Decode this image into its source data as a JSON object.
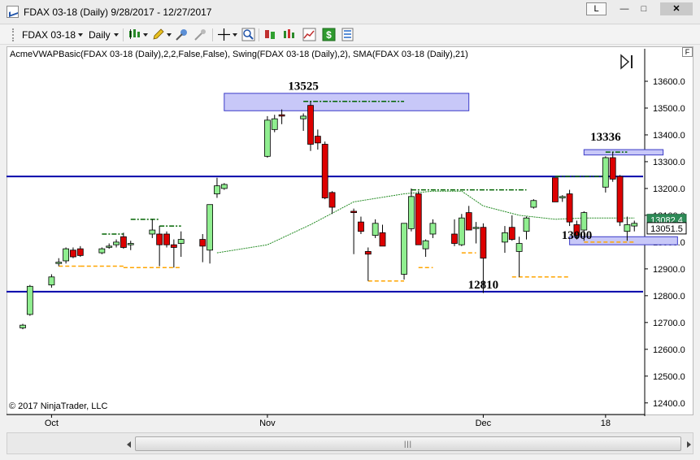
{
  "window": {
    "title": "FDAX 03-18 (Daily)  9/28/2017 - 12/27/2017",
    "link_button": "L",
    "minimize": "—",
    "maximize": "□",
    "close": "✕"
  },
  "toolbar": {
    "instrument": "FDAX 03-18",
    "period": "Daily",
    "icons": [
      "bar-type-icon",
      "drawing-pencil-icon",
      "global-draw-icon",
      "stay-in-draw-icon",
      "crosshair-icon",
      "zoom-icon",
      "strategies-icon",
      "indicators-icon",
      "chart-trader-icon",
      "properties-icon"
    ]
  },
  "chart": {
    "indicator_label": "AcmeVWAPBasic(FDAX 03-18 (Daily),2,2,False,False), Swing(FDAX 03-18 (Daily),2), SMA(FDAX 03-18 (Daily),21)",
    "copyright": "© 2017 NinjaTrader, LLC",
    "panel_marker": "F"
  },
  "colors": {
    "up_candle": "#90ee90",
    "down_candle": "#dd0000",
    "candle_outline": "#000000",
    "sma": "#228b22",
    "swing_high": "#006400",
    "swing_low": "#ffa500",
    "level_line": "#0000aa",
    "zone_fill": "#c8c8f8",
    "zone_stroke": "#3c3cc8"
  },
  "chart_data": {
    "type": "candlestick",
    "instrument": "FDAX 03-18 (Daily)",
    "date_range": "9/28/2017 - 12/27/2017",
    "ylim": [
      12350,
      13690
    ],
    "y_ticks": [
      12400,
      12500,
      12600,
      12700,
      12800,
      12900,
      13000,
      13100,
      13200,
      13300,
      13400,
      13500,
      13600
    ],
    "x_ticks": [
      {
        "label": "Oct",
        "date": "2017-10-02"
      },
      {
        "label": "Nov",
        "date": "2017-11-01"
      },
      {
        "label": "Dec",
        "date": "2017-12-01"
      },
      {
        "label": "18",
        "date": "2017-12-18"
      }
    ],
    "candles": [
      {
        "date": "2017-09-28",
        "open": 12680,
        "high": 12695,
        "low": 12675,
        "close": 12690
      },
      {
        "date": "2017-09-29",
        "open": 12730,
        "high": 12840,
        "low": 12725,
        "close": 12835
      },
      {
        "date": "2017-10-02",
        "open": 12840,
        "high": 12880,
        "low": 12830,
        "close": 12870
      },
      {
        "date": "2017-10-03",
        "open": 12920,
        "high": 12940,
        "low": 12910,
        "close": 12925
      },
      {
        "date": "2017-10-04",
        "open": 12930,
        "high": 12980,
        "low": 12920,
        "close": 12975
      },
      {
        "date": "2017-10-05",
        "open": 12970,
        "high": 12980,
        "low": 12940,
        "close": 12945
      },
      {
        "date": "2017-10-06",
        "open": 12975,
        "high": 12985,
        "low": 12945,
        "close": 12950
      },
      {
        "date": "2017-10-09",
        "open": 12960,
        "high": 12980,
        "low": 12955,
        "close": 12975
      },
      {
        "date": "2017-10-10",
        "open": 12985,
        "high": 12995,
        "low": 12975,
        "close": 12985
      },
      {
        "date": "2017-10-11",
        "open": 12990,
        "high": 13010,
        "low": 12980,
        "close": 13000
      },
      {
        "date": "2017-10-12",
        "open": 13020,
        "high": 13035,
        "low": 12975,
        "close": 12980
      },
      {
        "date": "2017-10-13",
        "open": 12990,
        "high": 13005,
        "low": 12970,
        "close": 12995
      },
      {
        "date": "2017-10-16",
        "open": 13030,
        "high": 13085,
        "low": 13015,
        "close": 13045
      },
      {
        "date": "2017-10-17",
        "open": 13030,
        "high": 13060,
        "low": 12910,
        "close": 12990
      },
      {
        "date": "2017-10-18",
        "open": 13030,
        "high": 13040,
        "low": 12980,
        "close": 12990
      },
      {
        "date": "2017-10-19",
        "open": 12990,
        "high": 13010,
        "low": 12905,
        "close": 12980
      },
      {
        "date": "2017-10-20",
        "open": 12995,
        "high": 13040,
        "low": 12945,
        "close": 13010
      },
      {
        "date": "2017-10-23",
        "open": 13010,
        "high": 13030,
        "low": 12925,
        "close": 12985
      },
      {
        "date": "2017-10-24",
        "open": 12970,
        "high": 13140,
        "low": 12920,
        "close": 13140
      },
      {
        "date": "2017-10-25",
        "open": 13180,
        "high": 13240,
        "low": 13165,
        "close": 13210
      },
      {
        "date": "2017-10-26",
        "open": 13200,
        "high": 13220,
        "low": 13195,
        "close": 13215
      },
      {
        "date": "2017-11-01",
        "open": 13320,
        "high": 13470,
        "low": 13315,
        "close": 13455
      },
      {
        "date": "2017-11-02",
        "open": 13420,
        "high": 13475,
        "low": 13410,
        "close": 13460
      },
      {
        "date": "2017-11-03",
        "open": 13475,
        "high": 13495,
        "low": 13440,
        "close": 13470
      },
      {
        "date": "2017-11-06",
        "open": 13460,
        "high": 13480,
        "low": 13415,
        "close": 13470
      },
      {
        "date": "2017-11-07",
        "open": 13510,
        "high": 13525,
        "low": 13340,
        "close": 13365
      },
      {
        "date": "2017-11-08",
        "open": 13395,
        "high": 13420,
        "low": 13345,
        "close": 13370
      },
      {
        "date": "2017-11-09",
        "open": 13365,
        "high": 13375,
        "low": 13160,
        "close": 13165
      },
      {
        "date": "2017-11-10",
        "open": 13185,
        "high": 13190,
        "low": 13105,
        "close": 13130
      },
      {
        "date": "2017-11-13",
        "open": 13115,
        "high": 13125,
        "low": 12955,
        "close": 13110
      },
      {
        "date": "2017-11-14",
        "open": 13075,
        "high": 13095,
        "low": 13030,
        "close": 13040
      },
      {
        "date": "2017-11-15",
        "open": 12965,
        "high": 12980,
        "low": 12855,
        "close": 12955
      },
      {
        "date": "2017-11-16",
        "open": 13025,
        "high": 13085,
        "low": 13015,
        "close": 13070
      },
      {
        "date": "2017-11-17",
        "open": 13035,
        "high": 13065,
        "low": 12985,
        "close": 12985
      },
      {
        "date": "2017-11-20",
        "open": 12880,
        "high": 12905,
        "low": 12860,
        "close": 13070
      },
      {
        "date": "2017-11-21",
        "open": 13050,
        "high": 13200,
        "low": 13040,
        "close": 13170
      },
      {
        "date": "2017-11-22",
        "open": 13180,
        "high": 13190,
        "low": 12990,
        "close": 12990
      },
      {
        "date": "2017-11-23",
        "open": 12975,
        "high": 13010,
        "low": 12945,
        "close": 13005
      },
      {
        "date": "2017-11-24",
        "open": 13030,
        "high": 13085,
        "low": 13015,
        "close": 13070
      },
      {
        "date": "2017-11-27",
        "open": 13030,
        "high": 13085,
        "low": 12985,
        "close": 12995
      },
      {
        "date": "2017-11-28",
        "open": 12990,
        "high": 13105,
        "low": 12985,
        "close": 13090
      },
      {
        "date": "2017-11-29",
        "open": 13110,
        "high": 13135,
        "low": 13045,
        "close": 13045
      },
      {
        "date": "2017-11-30",
        "open": 13055,
        "high": 13075,
        "low": 12995,
        "close": 13055
      },
      {
        "date": "2017-12-01",
        "open": 13055,
        "high": 13070,
        "low": 12810,
        "close": 12940
      },
      {
        "date": "2017-12-04",
        "open": 13000,
        "high": 13060,
        "low": 12960,
        "close": 13035
      },
      {
        "date": "2017-12-05",
        "open": 13055,
        "high": 13100,
        "low": 13005,
        "close": 13010
      },
      {
        "date": "2017-12-06",
        "open": 12965,
        "high": 13020,
        "low": 12870,
        "close": 12995
      },
      {
        "date": "2017-12-07",
        "open": 13040,
        "high": 13095,
        "low": 13010,
        "close": 13090
      },
      {
        "date": "2017-12-08",
        "open": 13130,
        "high": 13160,
        "low": 13125,
        "close": 13155
      },
      {
        "date": "2017-12-11",
        "open": 13240,
        "high": 13240,
        "low": 13150,
        "close": 13150
      },
      {
        "date": "2017-12-12",
        "open": 13165,
        "high": 13175,
        "low": 13150,
        "close": 13170
      },
      {
        "date": "2017-12-13",
        "open": 13180,
        "high": 13195,
        "low": 13060,
        "close": 13075
      },
      {
        "date": "2017-12-14",
        "open": 13065,
        "high": 13080,
        "low": 13010,
        "close": 13025
      },
      {
        "date": "2017-12-15",
        "open": 13045,
        "high": 13115,
        "low": 13005,
        "close": 13110
      },
      {
        "date": "2017-12-18",
        "open": 13205,
        "high": 13320,
        "low": 13185,
        "close": 13315
      },
      {
        "date": "2017-12-19",
        "open": 13315,
        "high": 13336,
        "low": 13225,
        "close": 13235
      },
      {
        "date": "2017-12-20",
        "open": 13245,
        "high": 13250,
        "low": 13060,
        "close": 13075
      },
      {
        "date": "2017-12-21",
        "open": 13040,
        "high": 13095,
        "low": 13005,
        "close": 13065
      },
      {
        "date": "2017-12-22",
        "open": 13060,
        "high": 13080,
        "low": 13040,
        "close": 13070
      },
      {
        "date": "2017-12-27",
        "open": 13051,
        "high": 13060,
        "low": 13040,
        "close": 13051
      }
    ],
    "sma": {
      "name": "SMA(FDAX 03-18 (Daily),21)",
      "points": [
        {
          "date": "2017-10-25",
          "value": 12960
        },
        {
          "date": "2017-11-01",
          "value": 12990
        },
        {
          "date": "2017-11-07",
          "value": 13065
        },
        {
          "date": "2017-11-13",
          "value": 13150
        },
        {
          "date": "2017-11-20",
          "value": 13180
        },
        {
          "date": "2017-11-24",
          "value": 13190
        },
        {
          "date": "2017-11-28",
          "value": 13190
        },
        {
          "date": "2017-12-01",
          "value": 13135
        },
        {
          "date": "2017-12-06",
          "value": 13100
        },
        {
          "date": "2017-12-11",
          "value": 13085
        },
        {
          "date": "2017-12-15",
          "value": 13090
        },
        {
          "date": "2017-12-22",
          "value": 13090
        }
      ]
    },
    "swing_highs": [
      {
        "from": "2017-10-09",
        "to": "2017-10-12",
        "value": 13030
      },
      {
        "from": "2017-10-13",
        "to": "2017-10-17",
        "value": 13085
      },
      {
        "from": "2017-10-17",
        "to": "2017-10-20",
        "value": 13060
      },
      {
        "from": "2017-11-06",
        "to": "2017-11-20",
        "value": 13525
      },
      {
        "from": "2017-11-21",
        "to": "2017-12-07",
        "value": 13195
      },
      {
        "from": "2017-12-11",
        "to": "2017-12-19",
        "value": 13245
      },
      {
        "from": "2017-12-18",
        "to": "2017-12-21",
        "value": 13336
      }
    ],
    "swing_lows": [
      {
        "from": "2017-10-03",
        "to": "2017-10-06",
        "value": 12910
      },
      {
        "from": "2017-10-06",
        "to": "2017-10-12",
        "value": 12910
      },
      {
        "from": "2017-10-12",
        "to": "2017-10-20",
        "value": 12905
      },
      {
        "from": "2017-11-15",
        "to": "2017-11-20",
        "value": 12855
      },
      {
        "from": "2017-11-22",
        "to": "2017-11-24",
        "value": 12905
      },
      {
        "from": "2017-11-28",
        "to": "2017-11-30",
        "value": 12960
      },
      {
        "from": "2017-12-05",
        "to": "2017-12-13",
        "value": 12870
      },
      {
        "from": "2017-12-15",
        "to": "2017-12-22",
        "value": 13000
      }
    ],
    "horizontal_lines": [
      13245,
      12815
    ],
    "zones": [
      {
        "label": "13525",
        "low": 13490,
        "high": 13555,
        "from": "2017-10-26",
        "to": "2017-11-29"
      },
      {
        "label": "13336",
        "low": 13325,
        "high": 13345,
        "from": "2017-12-15",
        "to": "2017-12-26"
      },
      {
        "label": "13000",
        "low": 12990,
        "high": 13020,
        "from": "2017-12-13",
        "to": "2017-12-28"
      }
    ],
    "annotations": [
      {
        "text": "13525",
        "value": 13525,
        "date": "2017-11-06"
      },
      {
        "text": "13336",
        "value": 13336,
        "date": "2017-12-18"
      },
      {
        "text": "13000",
        "value": 12970,
        "date": "2017-12-14"
      },
      {
        "text": "12810",
        "value": 12785,
        "date": "2017-12-01"
      }
    ],
    "price_markers": [
      {
        "text": "13082.4",
        "value": 13082.4,
        "style": "filled"
      },
      {
        "text": "13051.5",
        "value": 13051.5,
        "style": "outlined"
      }
    ]
  }
}
